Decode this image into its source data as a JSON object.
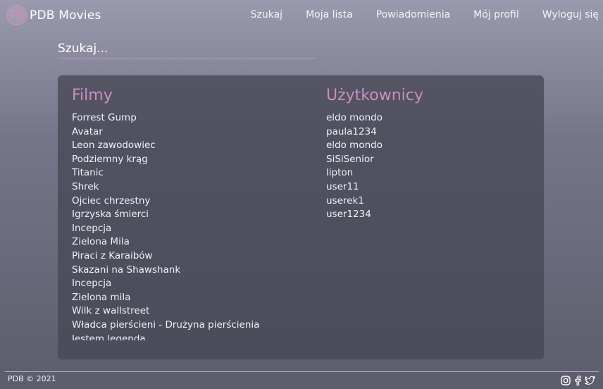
{
  "brand": {
    "title": "PDB Movies",
    "logo_icon": "pdb-logo-icon"
  },
  "nav": {
    "items": [
      {
        "label": "Szukaj"
      },
      {
        "label": "Moja lista"
      },
      {
        "label": "Powiadomienia"
      },
      {
        "label": "Mój profil"
      },
      {
        "label": "Wyloguj się"
      }
    ]
  },
  "search": {
    "placeholder": "Szukaj...",
    "value": ""
  },
  "results": {
    "movies_heading": "Filmy",
    "users_heading": "Użytkownicy",
    "movies": [
      "Forrest Gump",
      "Avatar",
      "Leon zawodowiec",
      "Podziemny krąg",
      "Titanic",
      "Shrek",
      "Ojciec chrzestny",
      "Igrzyska śmierci",
      "Incepcja",
      "Zielona Mila",
      "Piraci z Karaibów",
      "Skazani na Shawshank",
      "Incepcja",
      "Zielona mila",
      "Wilk z wallstreet",
      "Władca pierścieni - Drużyna pierścienia",
      "Jestem legenda"
    ],
    "users": [
      "eldo mondo",
      "paula1234",
      "eldo mondo",
      "SiSiSenior",
      "lipton",
      "user11",
      "userek1",
      "user1234"
    ]
  },
  "footer": {
    "copyright": "PDB © 2021",
    "social_icons": [
      "instagram-icon",
      "facebook-icon",
      "twitter-icon"
    ]
  },
  "colors": {
    "accent": "#c98fbf",
    "panel": "#4a4a58",
    "text": "#f2f2f6"
  }
}
